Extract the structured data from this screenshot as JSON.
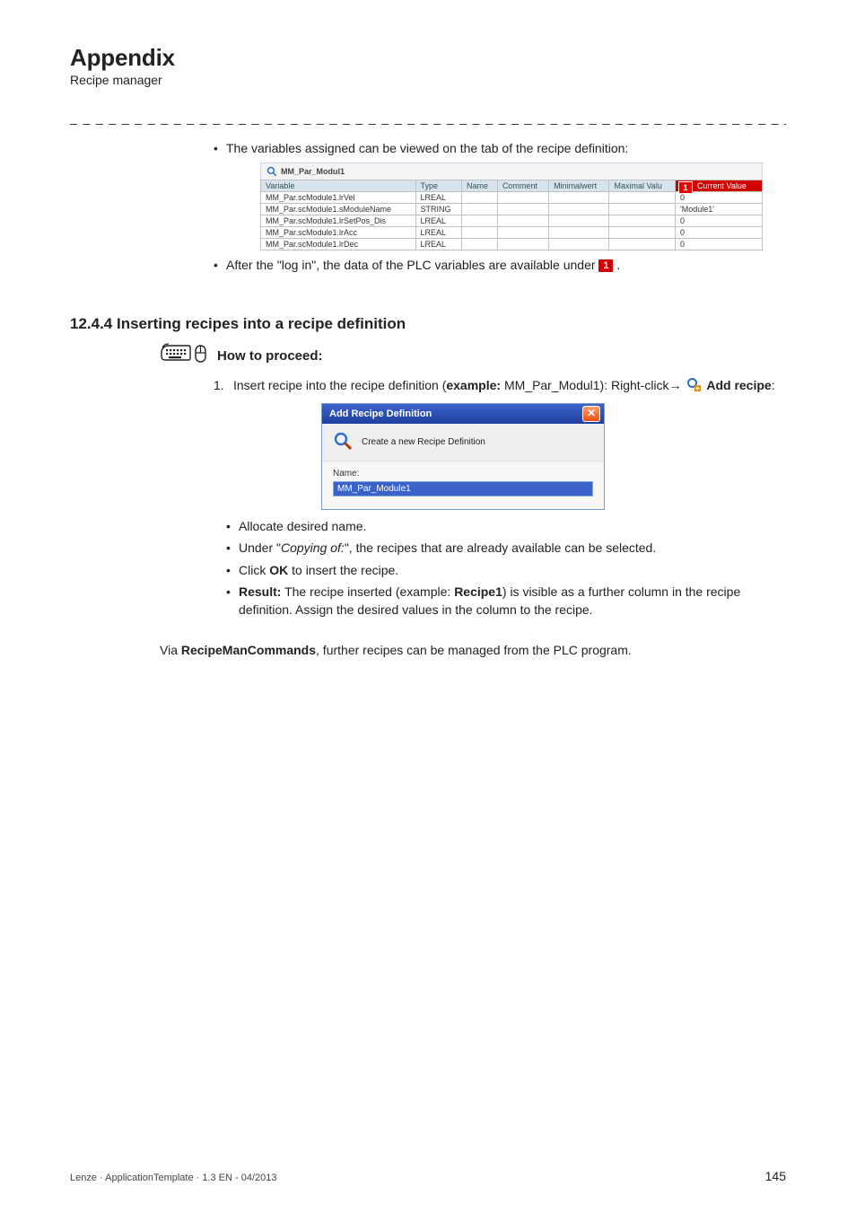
{
  "header": {
    "title": "Appendix",
    "subtitle": "Recipe manager",
    "dashes": "_ _ _ _ _ _ _ _ _ _ _ _ _ _ _ _ _ _ _ _ _ _ _ _ _ _ _ _ _ _ _ _ _ _ _ _ _ _ _ _ _ _ _ _ _ _ _ _ _ _ _ _ _ _ _ _ _ _ _ _ _ _ _ _"
  },
  "intro_bullet": "The variables assigned can be viewed on the tab of the recipe definition:",
  "fig1": {
    "tab_label": "MM_Par_Modul1",
    "headers": {
      "variable": "Variable",
      "type": "Type",
      "name": "Name",
      "comment": "Comment",
      "min": "Minimalwert",
      "max": "Maximal Valu",
      "current": "Current Value",
      "callout": "1"
    },
    "rows": [
      {
        "variable": "MM_Par.scModule1.lrVel",
        "type": "LREAL",
        "current": "0"
      },
      {
        "variable": "MM_Par.scModule1.sModuleName",
        "type": "STRING",
        "current": "'Module1'"
      },
      {
        "variable": "MM_Par.scModule1.lrSetPos_Dis",
        "type": "LREAL",
        "current": "0"
      },
      {
        "variable": "MM_Par.scModule1.lrAcc",
        "type": "LREAL",
        "current": "0"
      },
      {
        "variable": "MM_Par.scModule1.lrDec",
        "type": "LREAL",
        "current": "0"
      }
    ]
  },
  "after_login_parts": {
    "pre": "After the \"log in\", the data of the PLC variables are available under ",
    "marker": "1",
    "post": "."
  },
  "section": {
    "number": "12.4.4",
    "title": "Inserting recipes into a recipe definition"
  },
  "proceed_label": "How to proceed:",
  "step1_parts": {
    "pre": "Insert recipe into the recipe definition (",
    "example_strong": "example:",
    "example_val": " MM_Par_Modul1): Right-click",
    "arrow": "→",
    "post_strong": " Add recipe",
    "trail": ":"
  },
  "fig2": {
    "title": "Add Recipe Definition",
    "banner": "Create a new Recipe Definition",
    "name_label": "Name:",
    "name_value": "MM_Par_Module1",
    "close": "✕"
  },
  "sub_bullets": {
    "allocate": "Allocate desired name.",
    "under": {
      "pre": "Under \"",
      "it": "Copying of:",
      "post": "\", the recipes that are already available can be selected."
    },
    "click": {
      "pre": "Click ",
      "strong": "OK",
      "post": " to insert the recipe."
    },
    "result": {
      "label": "Result:",
      "mid1": " The recipe inserted (example: ",
      "strong": "Recipe1",
      "mid2": ") is visible as a further column in the recipe definition. Assign the desired values in the column to the recipe."
    }
  },
  "final_parts": {
    "pre": "Via ",
    "strong": "RecipeManCommands",
    "post": ", further recipes can be managed from the PLC program."
  },
  "footer": {
    "left": "Lenze · ApplicationTemplate · 1.3 EN - 04/2013",
    "page": "145"
  }
}
